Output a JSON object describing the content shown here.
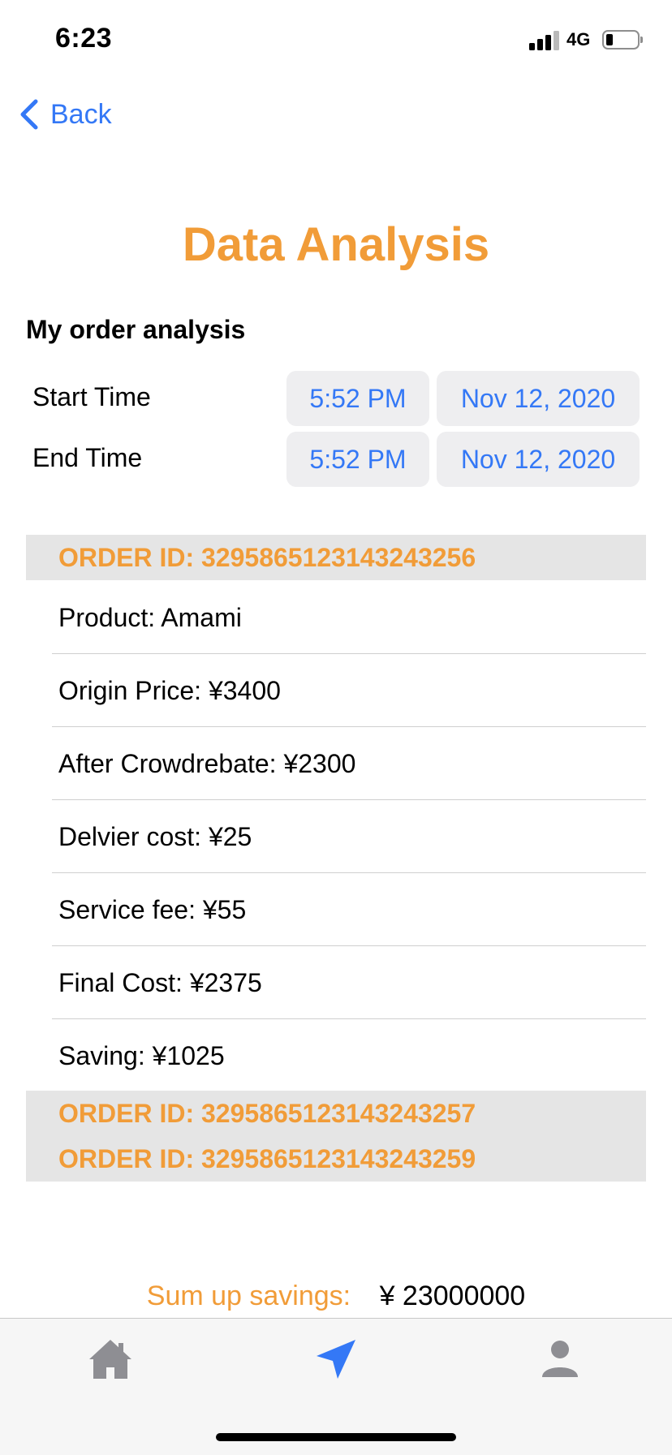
{
  "status_bar": {
    "time": "6:23",
    "network": "4G",
    "battery_level": 0.15
  },
  "nav": {
    "back_label": "Back"
  },
  "page": {
    "title": "Data Analysis",
    "section_title": "My order analysis"
  },
  "time_filters": [
    {
      "label": "Start Time",
      "time": "5:52 PM",
      "date": "Nov 12, 2020"
    },
    {
      "label": "End Time",
      "time": "5:52 PM",
      "date": "Nov 12, 2020"
    }
  ],
  "orders": [
    {
      "id_text": "ORDER ID: 3295865123143243256",
      "expanded": true
    },
    {
      "id_text": "ORDER ID: 3295865123143243257",
      "expanded": false
    },
    {
      "id_text": "ORDER ID: 3295865123143243259",
      "expanded": false
    }
  ],
  "order_details": [
    "Product: Amami",
    "Origin Price: ¥3400",
    "After Crowdrebate: ¥2300",
    "Delvier cost: ¥25",
    "Service fee: ¥55",
    "Final Cost: ¥2375",
    "Saving: ¥1025"
  ],
  "summary": {
    "label": "Sum up savings:",
    "value": "¥ 23000000"
  },
  "tab_bar": {
    "items": [
      {
        "icon": "house-icon",
        "active": false
      },
      {
        "icon": "paper-plane-icon",
        "active": true
      },
      {
        "icon": "person-icon",
        "active": false
      }
    ]
  },
  "colors": {
    "accent": "#f19c38",
    "link": "#3478f6",
    "inactive_tab": "#8e8e93",
    "header_bg": "#e5e5e5"
  }
}
